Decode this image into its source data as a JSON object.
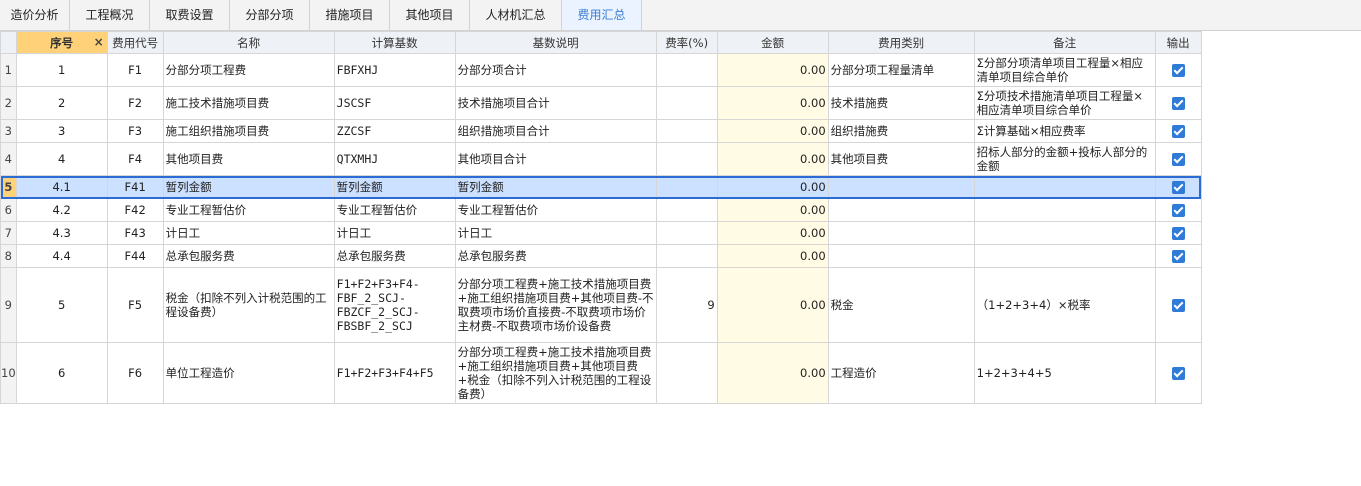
{
  "tabs": [
    {
      "label": "造价分析"
    },
    {
      "label": "工程概况"
    },
    {
      "label": "取费设置"
    },
    {
      "label": "分部分项"
    },
    {
      "label": "措施项目"
    },
    {
      "label": "其他项目"
    },
    {
      "label": "人材机汇总"
    },
    {
      "label": "费用汇总"
    }
  ],
  "active_tab": "费用汇总",
  "close_icon": "×",
  "headers": {
    "seq": "序号",
    "code": "费用代号",
    "name": "名称",
    "basis": "计算基数",
    "basis_desc": "基数说明",
    "rate": "费率(%)",
    "amount": "金额",
    "category": "费用类别",
    "remark": "备注",
    "output": "输出"
  },
  "rows": [
    {
      "rownum": "1",
      "seq": "1",
      "code": "F1",
      "name": "分部分项工程费",
      "basis": "FBFXHJ",
      "basis_desc": "分部分项合计",
      "rate": "",
      "amount": "0.00",
      "category": "分部分项工程量清单",
      "remark": "Σ分部分项清单项目工程量×相应清单项目综合单价",
      "output": true
    },
    {
      "rownum": "2",
      "seq": "2",
      "code": "F2",
      "name": "施工技术措施项目费",
      "basis": "JSCSF",
      "basis_desc": "技术措施项目合计",
      "rate": "",
      "amount": "0.00",
      "category": "技术措施费",
      "remark": "Σ分项技术措施清单项目工程量×相应清单项目综合单价",
      "output": true
    },
    {
      "rownum": "3",
      "seq": "3",
      "code": "F3",
      "name": "施工组织措施项目费",
      "basis": "ZZCSF",
      "basis_desc": "组织措施项目合计",
      "rate": "",
      "amount": "0.00",
      "category": "组织措施费",
      "remark": "Σ计算基础×相应费率",
      "output": true
    },
    {
      "rownum": "4",
      "seq": "4",
      "code": "F4",
      "name": "其他项目费",
      "basis": "QTXMHJ",
      "basis_desc": "其他项目合计",
      "rate": "",
      "amount": "0.00",
      "category": "其他项目费",
      "remark": "招标人部分的金额+投标人部分的金额",
      "output": true
    },
    {
      "rownum": "5",
      "seq": "4.1",
      "code": "F41",
      "name": "暂列金额",
      "basis": "暂列金额",
      "basis_desc": "暂列金额",
      "rate": "",
      "amount": "0.00",
      "category": "",
      "remark": "",
      "output": true
    },
    {
      "rownum": "6",
      "seq": "4.2",
      "code": "F42",
      "name": "专业工程暂估价",
      "basis": "专业工程暂估价",
      "basis_desc": "专业工程暂估价",
      "rate": "",
      "amount": "0.00",
      "category": "",
      "remark": "",
      "output": true
    },
    {
      "rownum": "7",
      "seq": "4.3",
      "code": "F43",
      "name": "计日工",
      "basis": "计日工",
      "basis_desc": "计日工",
      "rate": "",
      "amount": "0.00",
      "category": "",
      "remark": "",
      "output": true
    },
    {
      "rownum": "8",
      "seq": "4.4",
      "code": "F44",
      "name": "总承包服务费",
      "basis": "总承包服务费",
      "basis_desc": "总承包服务费",
      "rate": "",
      "amount": "0.00",
      "category": "",
      "remark": "",
      "output": true
    },
    {
      "rownum": "9",
      "seq": "5",
      "code": "F5",
      "name": "税金（扣除不列入计税范围的工程设备费）",
      "basis": "F1+F2+F3+F4-FBF_2_SCJ-FBZCF_2_SCJ-FBSBF_2_SCJ",
      "basis_desc": "分部分项工程费+施工技术措施项目费+施工组织措施项目费+其他项目费-不取费项市场价直接费-不取费项市场价主材费-不取费项市场价设备费",
      "rate": "9",
      "amount": "0.00",
      "category": "税金",
      "remark": "（1+2+3+4）×税率",
      "output": true
    },
    {
      "rownum": "10",
      "seq": "6",
      "code": "F6",
      "name": "单位工程造价",
      "basis": "F1+F2+F3+F4+F5",
      "basis_desc": "分部分项工程费+施工技术措施项目费+施工组织措施项目费+其他项目费+税金（扣除不列入计税范围的工程设备费）",
      "rate": "",
      "amount": "0.00",
      "category": "工程造价",
      "remark": "1+2+3+4+5",
      "output": true
    }
  ],
  "selected_row": 4
}
